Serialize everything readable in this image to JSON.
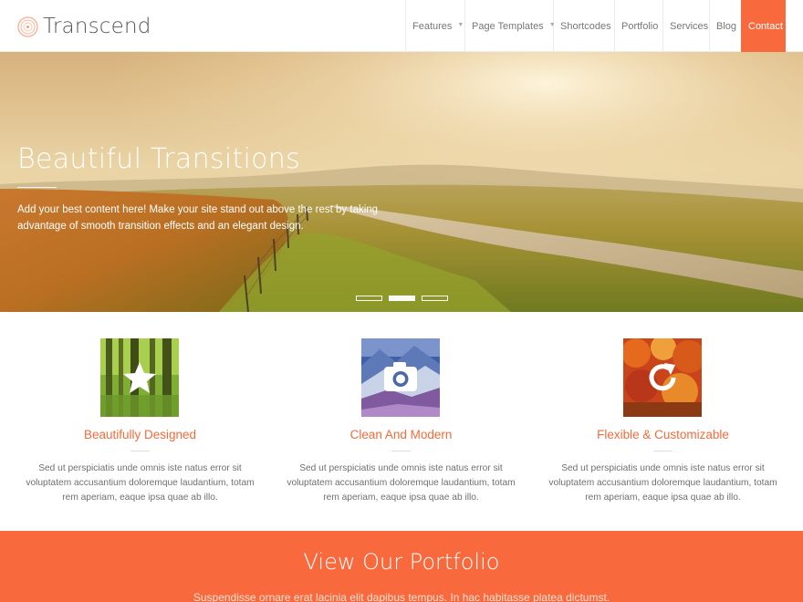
{
  "brand": {
    "name": "Transcend",
    "accent": "#f86a3d"
  },
  "nav": {
    "items": [
      {
        "label": "Features",
        "dropdown": true
      },
      {
        "label": "Page Templates",
        "dropdown": true
      },
      {
        "label": "Shortcodes",
        "dropdown": false
      },
      {
        "label": "Portfolio",
        "dropdown": false
      },
      {
        "label": "Services",
        "dropdown": false
      },
      {
        "label": "Blog",
        "dropdown": false
      },
      {
        "label": "Contact",
        "dropdown": false,
        "active": true
      }
    ],
    "caret": "chevron-down-icon"
  },
  "hero": {
    "title": "Beautiful Transitions",
    "text": "Add your best content here! Make your site stand out above the rest by taking advantage of smooth transition effects and an elegant design.",
    "slides": 3,
    "active_slide": 2
  },
  "features": [
    {
      "title": "Beautifully Designed",
      "icon": "star-icon",
      "text": "Sed ut perspiciatis unde omnis iste natus error sit voluptatem accusantium doloremque laudantium, totam rem aperiam, eaque ipsa quae ab illo."
    },
    {
      "title": "Clean And Modern",
      "icon": "camera-icon",
      "text": "Sed ut perspiciatis unde omnis iste natus error sit voluptatem accusantium doloremque laudantium, totam rem aperiam, eaque ipsa quae ab illo."
    },
    {
      "title": "Flexible & Customizable",
      "icon": "refresh-icon",
      "text": "Sed ut perspiciatis unde omnis iste natus error sit voluptatem accusantium doloremque laudantium, totam rem aperiam, eaque ipsa quae ab illo."
    }
  ],
  "portfolio": {
    "title": "View Our Portfolio",
    "text": "Suspendisse ornare erat lacinia elit dapibus tempus. In hac habitasse platea dictumst."
  }
}
